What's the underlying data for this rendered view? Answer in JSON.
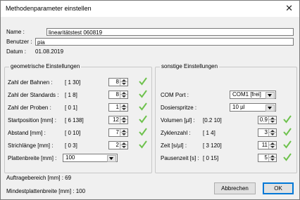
{
  "window": {
    "title": "Methodenparameter einstellen",
    "close_glyph": "✕"
  },
  "info": {
    "name_label": "Name :",
    "name_value": "linearitätstest 060819",
    "user_label": "Benutzer :",
    "user_value": "pia",
    "date_label": "Datum :",
    "date_value": "01.08.2019"
  },
  "geo": {
    "title": "geometrische Einstellungen",
    "rows": [
      {
        "label": "Zahl der Bahnen :",
        "range": "[ 1    30]",
        "value": "8"
      },
      {
        "label": "Zahl der Standards :",
        "range": "[ 1    8]",
        "value": "8"
      },
      {
        "label": "Zahl der Proben :",
        "range": "[ 0    1]",
        "value": "1"
      },
      {
        "label": "Startposition [mm] :",
        "range": "[ 6    138]",
        "value": "12"
      },
      {
        "label": "Abstand [mm] :",
        "range": "[ 0    10]",
        "value": "7"
      },
      {
        "label": "Strichlänge [mm] :",
        "range": "[ 0    3]",
        "value": "2"
      }
    ],
    "plate_label": "Plattenbreite [mm] :",
    "plate_value": "100"
  },
  "other": {
    "title": "sonstige Einstellungen",
    "com_label": "COM Port :",
    "com_value": "COM1 [frei]",
    "syringe_label": "Dosierspritze :",
    "syringe_value": "10 µl",
    "rows": [
      {
        "label": "Volumen [µl] :",
        "range": "[0.2    10]",
        "value": "0.9"
      },
      {
        "label": "Zyklenzahl :",
        "range": "[ 1    4]",
        "value": "3"
      },
      {
        "label": "Zeit [s/µl] :",
        "range": "[ 3    120]",
        "value": "11"
      },
      {
        "label": "Pausenzeit [s] :",
        "range": "[ 0    15]",
        "value": "5"
      }
    ]
  },
  "footer": {
    "auftrag": "Auftragebereich [mm] : 69",
    "mindest": "Mindestplattenbreite [mm] : 100",
    "cancel_label": "Abbrechen",
    "ok_label": "OK"
  },
  "colors": {
    "check": "#6ec24d",
    "accent": "#0078d7"
  }
}
